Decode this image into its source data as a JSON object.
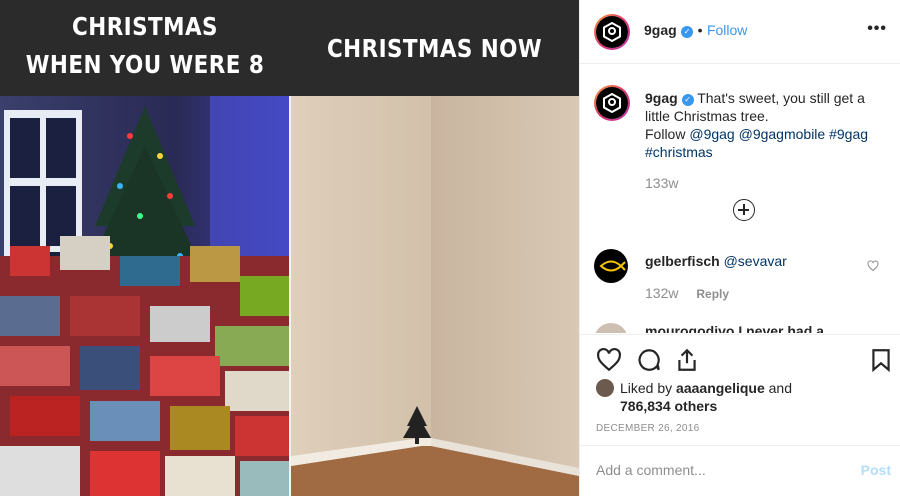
{
  "meme": {
    "caption_left_line1": "CHRISTMAS",
    "caption_left_line2": "WHEN YOU WERE 8",
    "caption_right": "CHRISTMAS NOW"
  },
  "post": {
    "username": "9gag",
    "follow_label": "Follow",
    "more_label": "•••",
    "dot_sep": "•"
  },
  "caption": {
    "username": "9gag",
    "text": "That's sweet, you still get a little Christmas tree.",
    "follow_prefix": "Follow",
    "mentions": [
      "@9gag",
      "@9gagmobile",
      "#9gag",
      "#christmas"
    ],
    "time": "133w"
  },
  "comments": [
    {
      "username": "gelberfisch",
      "text": "@sevavar",
      "time": "132w",
      "reply_label": "Reply"
    }
  ],
  "partial_comment": "mourogodivo I never had a",
  "likes": {
    "prefix": "Liked by",
    "user": "aaaangelique",
    "and": "and",
    "count_text": "786,834 others"
  },
  "date": "DECEMBER 26, 2016",
  "add_comment": {
    "placeholder": "Add a comment...",
    "post_label": "Post"
  },
  "icons": {
    "heart": "heart-icon",
    "comment": "comment-icon",
    "share": "share-icon",
    "bookmark": "bookmark-icon",
    "more": "more-icon"
  },
  "colors": {
    "link": "#003569",
    "follow": "#3897f0",
    "muted": "#8e8e8e",
    "post_disabled": "#b2dffc"
  }
}
